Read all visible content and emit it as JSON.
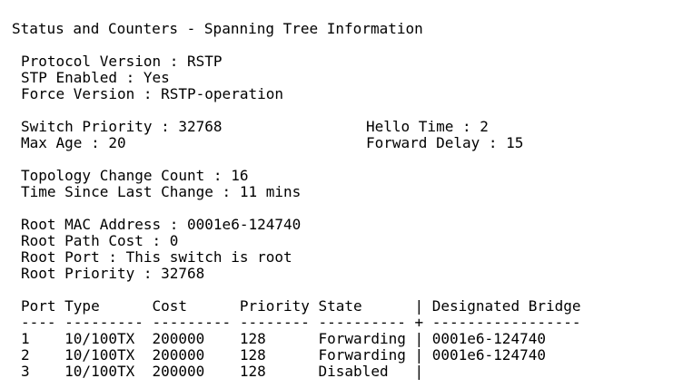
{
  "title": "Status and Counters - Spanning Tree Information",
  "protocol": {
    "version": "Protocol Version : RSTP",
    "stp_enabled": "STP Enabled : Yes",
    "force_version": "Force Version : RSTP-operation"
  },
  "timers": {
    "switch_priority": "Switch Priority : 32768",
    "hello_time": "Hello Time : 2",
    "max_age": "Max Age : 20",
    "forward_delay": "Forward Delay : 15"
  },
  "topology": {
    "change_count": "Topology Change Count : 16",
    "time_since_change": "Time Since Last Change : 11 mins"
  },
  "root": {
    "mac_address": "Root MAC Address : 0001e6-124740",
    "path_cost": "Root Path Cost : 0",
    "port": "Root Port : This switch is root",
    "priority": "Root Priority : 32768"
  },
  "table": {
    "header": "Port Type      Cost      Priority State      | Designated Bridge",
    "separator": "---- --------- --------- -------- ---------- + -----------------",
    "rows": [
      "1    10/100TX  200000    128      Forwarding | 0001e6-124740",
      "2    10/100TX  200000    128      Forwarding | 0001e6-124740",
      "3    10/100TX  200000    128      Disabled   |"
    ]
  }
}
